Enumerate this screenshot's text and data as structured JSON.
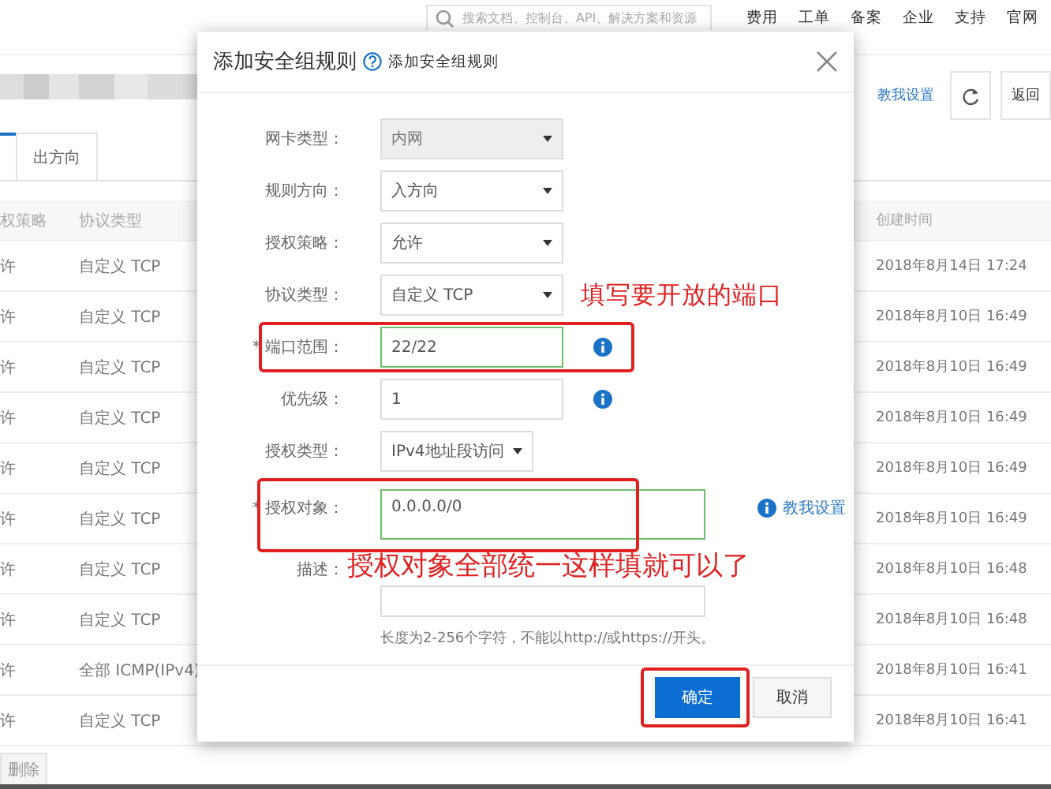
{
  "topbar": {
    "search": {
      "placeholder": "搜索文档、控制台、API、解决方案和资源"
    },
    "nav": [
      "费用",
      "工单",
      "备案",
      "企业",
      "支持",
      "官网"
    ]
  },
  "header": {
    "help_link": "教我设置",
    "back_button": "返回"
  },
  "tabs": [
    {
      "label": "出方向",
      "selected": false
    }
  ],
  "table": {
    "columns": [
      "权策略",
      "协议类型",
      "创建时间"
    ],
    "rows": [
      {
        "policy": "许",
        "protocol": "自定义 TCP",
        "created": "2018年8月14日 17:24"
      },
      {
        "policy": "许",
        "protocol": "自定义 TCP",
        "created": "2018年8月10日 16:49"
      },
      {
        "policy": "许",
        "protocol": "自定义 TCP",
        "created": "2018年8月10日 16:49"
      },
      {
        "policy": "许",
        "protocol": "自定义 TCP",
        "created": "2018年8月10日 16:49"
      },
      {
        "policy": "许",
        "protocol": "自定义 TCP",
        "created": "2018年8月10日 16:49"
      },
      {
        "policy": "许",
        "protocol": "自定义 TCP",
        "created": "2018年8月10日 16:49"
      },
      {
        "policy": "许",
        "protocol": "自定义 TCP",
        "created": "2018年8月10日 16:48"
      },
      {
        "policy": "许",
        "protocol": "自定义 TCP",
        "created": "2018年8月10日 16:48"
      },
      {
        "policy": "许",
        "protocol": "全部 ICMP(IPv4)",
        "created": "2018年8月10日 16:41"
      },
      {
        "policy": "许",
        "protocol": "自定义 TCP",
        "created": "2018年8月10日 16:41"
      }
    ]
  },
  "delete_button": {
    "label": "删除",
    "disabled": true
  },
  "dialog": {
    "title": "添加安全组规则",
    "help": "添加安全组规则",
    "fields": [
      {
        "label": "网卡类型：",
        "kind": "select",
        "value": "内网",
        "disabled": true,
        "info": false,
        "highlighted": false
      },
      {
        "label": "规则方向：",
        "kind": "select",
        "value": "入方向",
        "disabled": false,
        "info": false,
        "highlighted": false
      },
      {
        "label": "授权策略：",
        "kind": "select",
        "value": "允许",
        "disabled": false,
        "info": false,
        "highlighted": false
      },
      {
        "label": "协议类型：",
        "kind": "select",
        "value": "自定义 TCP",
        "disabled": false,
        "info": false,
        "highlighted": false,
        "note": "填写要开放的端口"
      },
      {
        "label": "* 端口范围：",
        "kind": "input",
        "value": "22/22",
        "disabled": false,
        "info": true,
        "highlighted": true
      },
      {
        "label": "优先级：",
        "kind": "input",
        "value": "1",
        "disabled": false,
        "info": true,
        "highlighted": false
      },
      {
        "label": "授权类型：",
        "kind": "compact-select",
        "value": "IPv4地址段访问",
        "disabled": false,
        "info": false,
        "highlighted": false
      },
      {
        "label": "* 授权对象：",
        "kind": "textarea",
        "value": "0.0.0.0/0",
        "disabled": false,
        "info": false,
        "highlighted": true,
        "link": "教我设置"
      },
      {
        "label": "描述：",
        "kind": "textarea",
        "disabled": false,
        "info": false,
        "highlighted": false,
        "note": "授权对象全部统一这样填就可以了",
        "hint": "长度为2-256个字符，不能以http://或https://开头。"
      }
    ],
    "buttons": [
      {
        "label": "确定",
        "primary": true,
        "highlighted": true
      },
      {
        "label": "取消",
        "primary": false,
        "highlighted": false
      }
    ]
  }
}
